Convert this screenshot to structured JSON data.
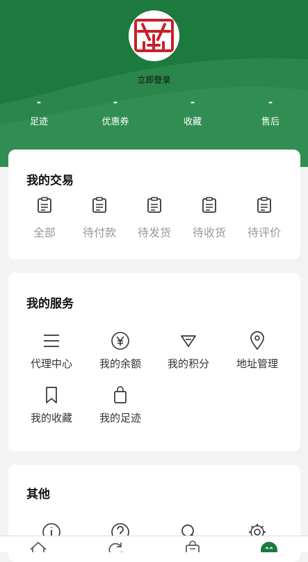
{
  "profile": {
    "login_label": "立即登录",
    "stats": [
      {
        "value": "-",
        "label": "足迹"
      },
      {
        "value": "-",
        "label": "优惠券"
      },
      {
        "value": "-",
        "label": "收藏"
      },
      {
        "value": "-",
        "label": "售后"
      }
    ]
  },
  "trade": {
    "title": "我的交易",
    "items": [
      {
        "label": "全部",
        "icon": "clipboard-icon"
      },
      {
        "label": "待付款",
        "icon": "clipboard-icon"
      },
      {
        "label": "待发货",
        "icon": "clipboard-icon"
      },
      {
        "label": "待收货",
        "icon": "clipboard-icon"
      },
      {
        "label": "待评价",
        "icon": "clipboard-icon"
      }
    ]
  },
  "services": {
    "title": "我的服务",
    "items": [
      {
        "label": "代理中心",
        "icon": "menu-lines-icon"
      },
      {
        "label": "我的余额",
        "icon": "yen-icon"
      },
      {
        "label": "我的积分",
        "icon": "points-icon"
      },
      {
        "label": "地址管理",
        "icon": "location-pin-icon"
      },
      {
        "label": "我的收藏",
        "icon": "bookmark-icon"
      },
      {
        "label": "我的足迹",
        "icon": "shopping-bag-icon"
      }
    ]
  },
  "other": {
    "title": "其他",
    "items": [
      {
        "icon": "info-icon"
      },
      {
        "icon": "help-icon"
      },
      {
        "icon": "search-icon"
      },
      {
        "icon": "settings-gear-icon"
      }
    ]
  },
  "tabbar": {
    "items": [
      {
        "icon": "home-icon"
      },
      {
        "icon": "refresh-icon"
      },
      {
        "icon": "cart-bag-icon"
      },
      {
        "icon": "profile-face-icon"
      }
    ]
  },
  "colors": {
    "brand_green": "#1d7a3f",
    "logo_red": "#c8202a"
  }
}
